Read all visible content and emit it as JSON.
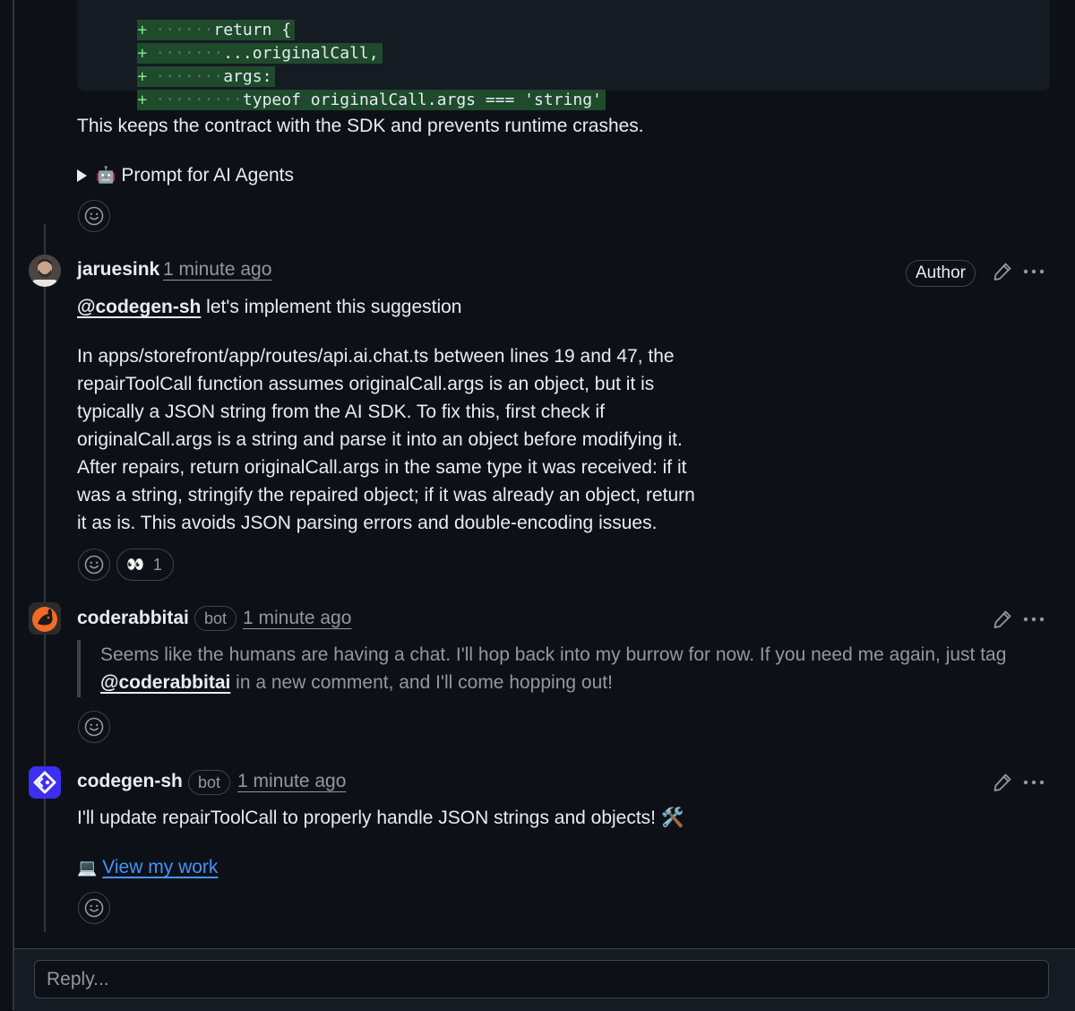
{
  "code": {
    "lines": [
      {
        "marker": "+",
        "indent": "······",
        "text": "return {"
      },
      {
        "marker": "+",
        "indent": "·······",
        "text": "...originalCall,"
      },
      {
        "marker": "+",
        "indent": "·······",
        "text": "args:"
      },
      {
        "marker": "+",
        "indent": "·········",
        "text": "typeof originalCall.args === 'string'"
      }
    ]
  },
  "comment0": {
    "body": "This keeps the contract with the SDK and prevents runtime crashes.",
    "details_icon": "🤖",
    "details_summary": "Prompt for AI Agents"
  },
  "comment1": {
    "author": "jaruesink",
    "time": "1 minute ago",
    "role_badge": "Author",
    "mention": "@codegen-sh",
    "mention_rest": " let's implement this suggestion",
    "body_lines": [
      "In apps/storefront/app/routes/api.ai.chat.ts between lines 19 and 47, the",
      "repairToolCall function assumes originalCall.args is an object, but it is",
      "typically a JSON string from the AI SDK. To fix this, first check if",
      "originalCall.args is a string and parse it into an object before modifying it.",
      "After repairs, return originalCall.args in the same type it was received: if it",
      "was a string, stringify the repaired object; if it was already an object, return",
      "it as is. This avoids JSON parsing errors and double-encoding issues."
    ],
    "reaction": {
      "emoji": "👀",
      "count": "1"
    }
  },
  "comment2": {
    "author": "coderabbitai",
    "badge": "bot",
    "time": "1 minute ago",
    "quote_line1": "Seems like the humans are having a chat. I'll hop back into my burrow for now. If you need me again, just tag",
    "quote_mention": "@coderabbitai",
    "quote_rest": " in a new comment, and I'll come hopping out!"
  },
  "comment3": {
    "author": "codegen-sh",
    "badge": "bot",
    "time": "1 minute ago",
    "body": "I'll update repairToolCall to properly handle JSON strings and objects! 🛠️",
    "link_icon": "💻",
    "link_text": "View my work"
  },
  "reply": {
    "placeholder": "Reply..."
  },
  "colors": {
    "background": "#0d1117",
    "border": "#3d444d",
    "muted_text": "#9198a1",
    "link": "#4493f8",
    "added_line_bg": "#1f4a2c",
    "coderabbit_orange": "#f46a26",
    "codegen_blue": "#3b2ff0"
  },
  "icons": [
    "smiley-icon",
    "pencil-icon",
    "kebab-icon",
    "triangle-right-icon"
  ]
}
